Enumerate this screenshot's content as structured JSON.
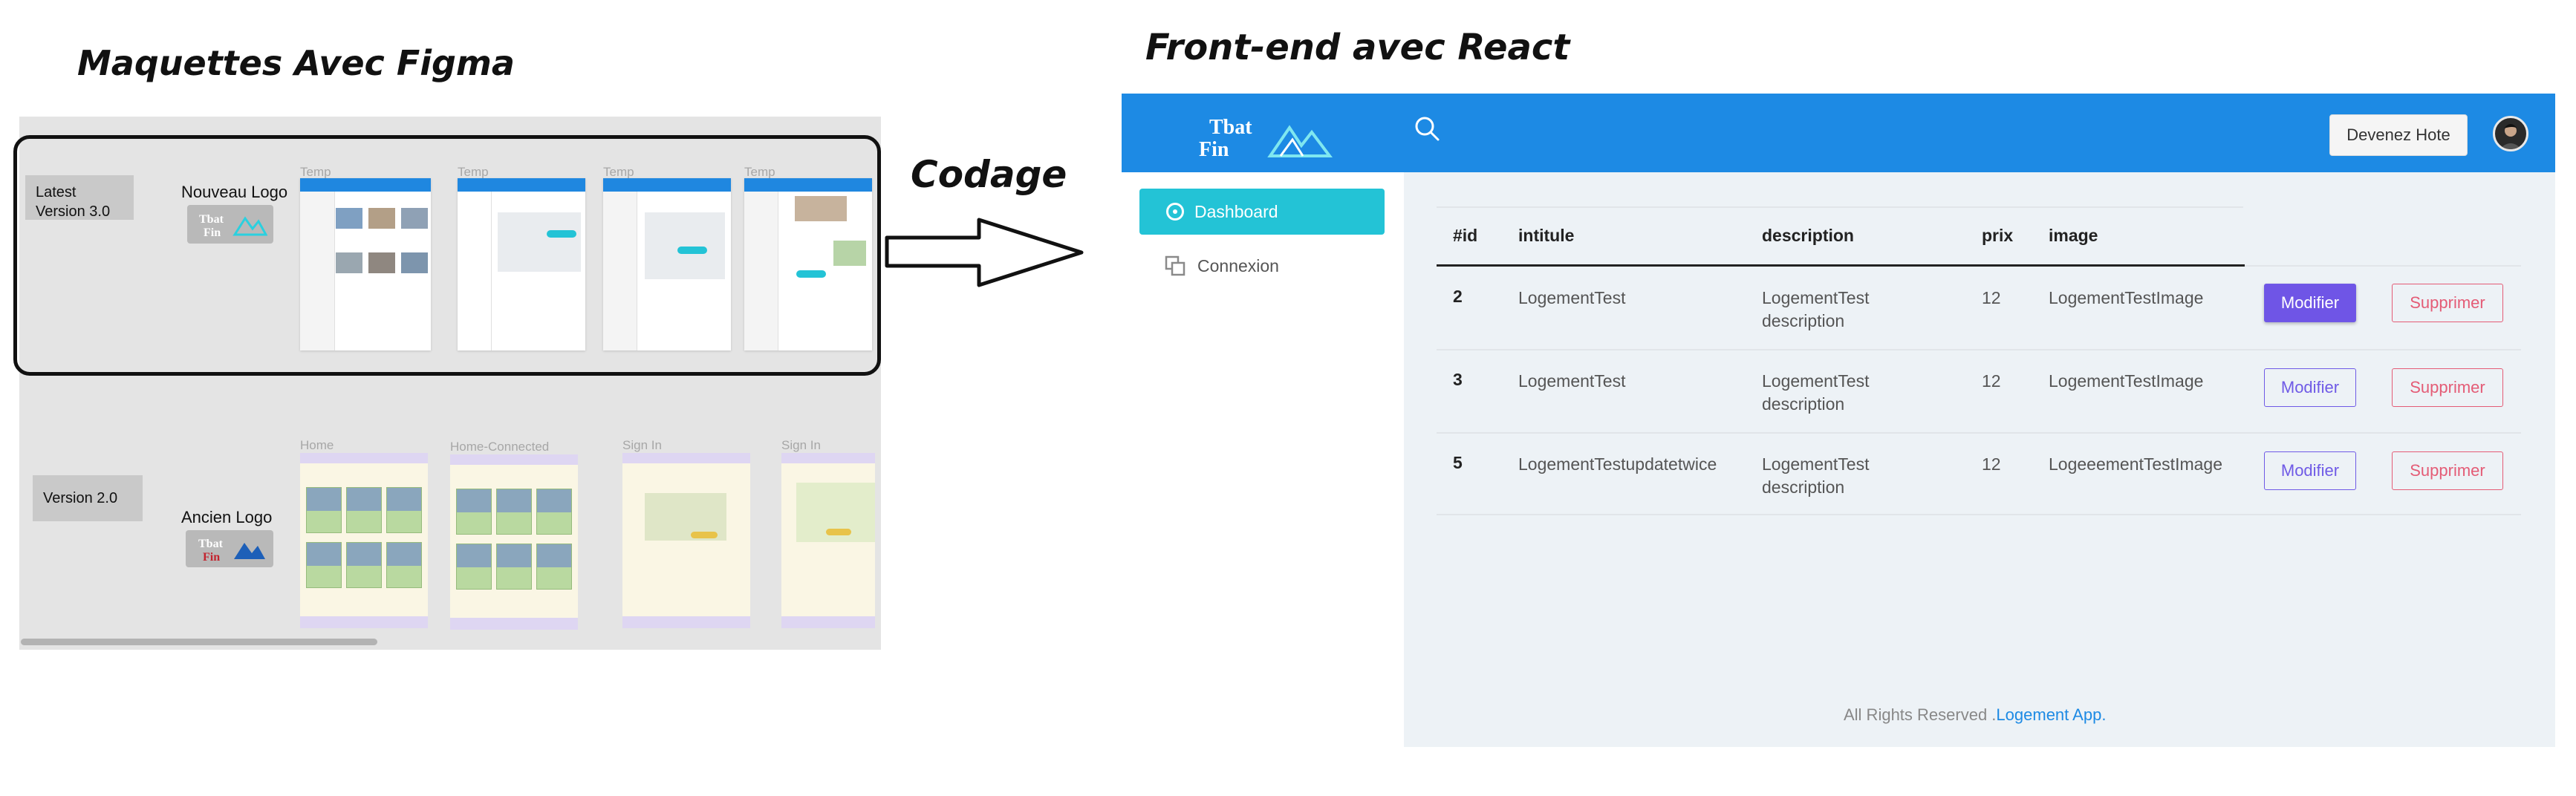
{
  "headings": {
    "left": "Maquettes Avec Figma",
    "right": "Front-end avec React",
    "arrow": "Codage"
  },
  "figma": {
    "latest_tag": "Latest Version 3.0",
    "latest_logo_label": "Nouveau Logo",
    "old_tag": "Version 2.0",
    "old_logo_label": "Ancien Logo",
    "latest_frames": [
      "Temp",
      "Temp",
      "Temp",
      "Temp"
    ],
    "old_frames": [
      "Home",
      "Home-Connected",
      "Sign In",
      "Sign In"
    ]
  },
  "app": {
    "logo_text": "Tbat Fin",
    "devenez_label": "Devenez Hote",
    "nav": {
      "dashboard": "Dashboard",
      "connexion": "Connexion"
    },
    "table": {
      "headers": [
        "#id",
        "intitule",
        "description",
        "prix",
        "image"
      ],
      "rows": [
        {
          "id": "2",
          "intitule": "LogementTest",
          "desc1": "LogementTest",
          "desc2": "description",
          "prix": "12",
          "image": "LogementTestImage",
          "modifier": "Modifier",
          "supprimer": "Supprimer"
        },
        {
          "id": "3",
          "intitule": "LogementTest",
          "desc1": "LogementTest",
          "desc2": "description",
          "prix": "12",
          "image": "LogementTestImage",
          "modifier": "Modifier",
          "supprimer": "Supprimer"
        },
        {
          "id": "5",
          "intitule": "LogementTestupdatetwice",
          "desc1": "LogementTest",
          "desc2": "description",
          "prix": "12",
          "image": "LogeeementTestImage",
          "modifier": "Modifier",
          "supprimer": "Supprimer"
        }
      ]
    },
    "footer_text": "All Rights Reserved .",
    "footer_link": "Logement App."
  },
  "colors": {
    "topbar": "#1d8ae4",
    "dashboard": "#23c3d6",
    "modifier": "#6f55e6",
    "supprimer": "#e45c76"
  }
}
